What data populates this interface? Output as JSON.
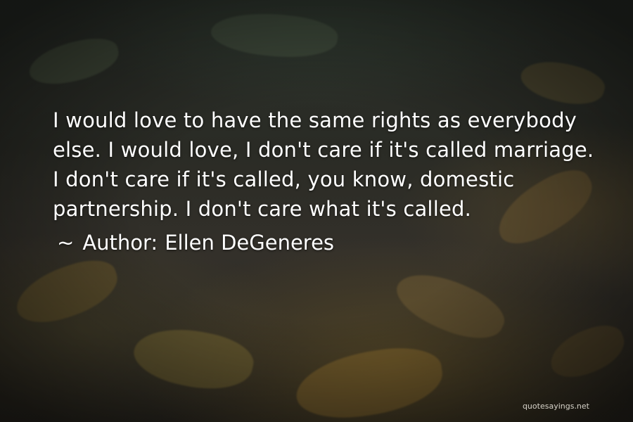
{
  "quote": {
    "text": "I would love to have the same rights as everybody else. I would love, I don't care if it's called marriage. I don't care if it's called, you know, domestic partnership. I don't care what it's called.",
    "prefix": "~",
    "author_label": "Author:",
    "author_name": "Ellen DeGeneres"
  },
  "watermark": {
    "text": "quotesayings.net"
  }
}
